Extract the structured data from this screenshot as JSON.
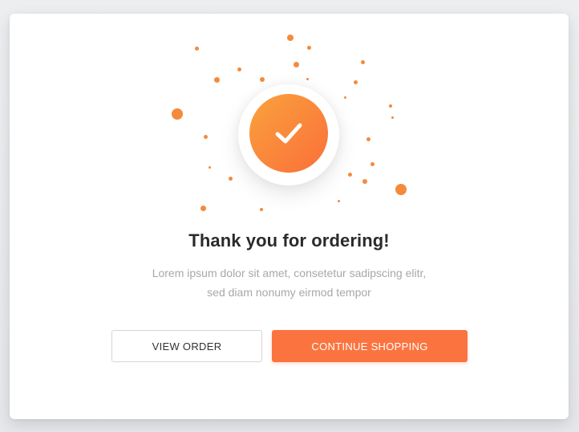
{
  "dialog": {
    "title": "Thank you for ordering!",
    "subtitle_line1": "Lorem ipsum dolor sit amet, consetetur sadipscing elitr,",
    "subtitle_line2": "sed diam nonumy eirmod tempor",
    "view_order_label": "VIEW ORDER",
    "continue_label": "CONTINUE SHOPPING",
    "success_icon": "checkmark-icon"
  },
  "colors": {
    "accent": "#fb7440",
    "accent_gradient_start": "#f9a23c",
    "accent_gradient_end": "#fb6f3a",
    "title": "#2b2b2b",
    "subtitle": "#a8a8a8",
    "confetti": "#f58a3c"
  }
}
